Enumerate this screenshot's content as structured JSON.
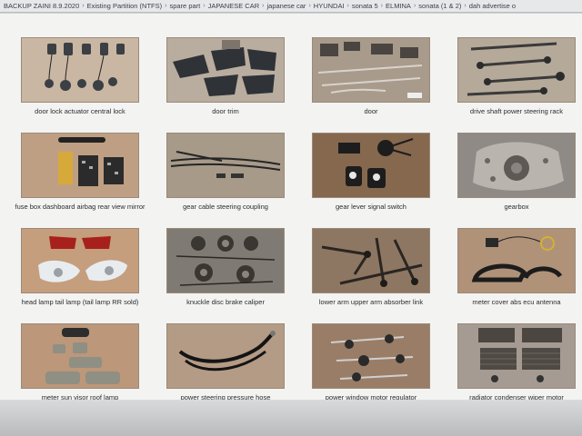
{
  "breadcrumb": [
    "BACKUP ZAINI 8.9.2020",
    "Existing Partition (NTFS)",
    "spare part",
    "JAPANESE CAR",
    "japanese car",
    "HYUNDAI",
    "sonata 5",
    "ELMINA",
    "sonata (1 & 2)",
    "dah advertise o"
  ],
  "tiles": [
    {
      "caption": "door lock actuator central lock",
      "icon": "door-lock-actuator-photo",
      "bg": "#c9b7a3"
    },
    {
      "caption": "door trim",
      "icon": "door-trim-photo",
      "bg": "#b8ad9f"
    },
    {
      "caption": "door",
      "icon": "door-photo",
      "bg": "#a89b8c"
    },
    {
      "caption": "drive shaft power steering rack",
      "icon": "drive-shaft-photo",
      "bg": "#b5a999"
    },
    {
      "caption": "fuse box dashboard airbag rear view mirror",
      "icon": "fuse-box-photo",
      "bg": "#bf9f83"
    },
    {
      "caption": "gear cable steering coupling",
      "icon": "gear-cable-photo",
      "bg": "#a79a89"
    },
    {
      "caption": "gear lever signal switch",
      "icon": "gear-lever-photo",
      "bg": "#86684e"
    },
    {
      "caption": "gearbox",
      "icon": "gearbox-photo",
      "bg": "#8f8a86"
    },
    {
      "caption": "head lamp tail lamp (tail lamp RR sold)",
      "icon": "head-lamp-photo",
      "bg": "#c59e7e"
    },
    {
      "caption": "knuckle disc brake caliper",
      "icon": "brake-caliper-photo",
      "bg": "#7f7b74"
    },
    {
      "caption": "lower arm upper arm absorber link",
      "icon": "lower-arm-photo",
      "bg": "#8d7762"
    },
    {
      "caption": "meter cover abs ecu antenna",
      "icon": "meter-cover-photo",
      "bg": "#b09279"
    },
    {
      "caption": "meter sun visor roof lamp",
      "icon": "sun-visor-photo",
      "bg": "#bc9779"
    },
    {
      "caption": "power steering pressure hose",
      "icon": "pressure-hose-photo",
      "bg": "#b49b85"
    },
    {
      "caption": "power window motor regulator",
      "icon": "window-motor-photo",
      "bg": "#9a7d66"
    },
    {
      "caption": "radiator condenser wiper motor",
      "icon": "radiator-photo",
      "bg": "#a59b92"
    }
  ]
}
